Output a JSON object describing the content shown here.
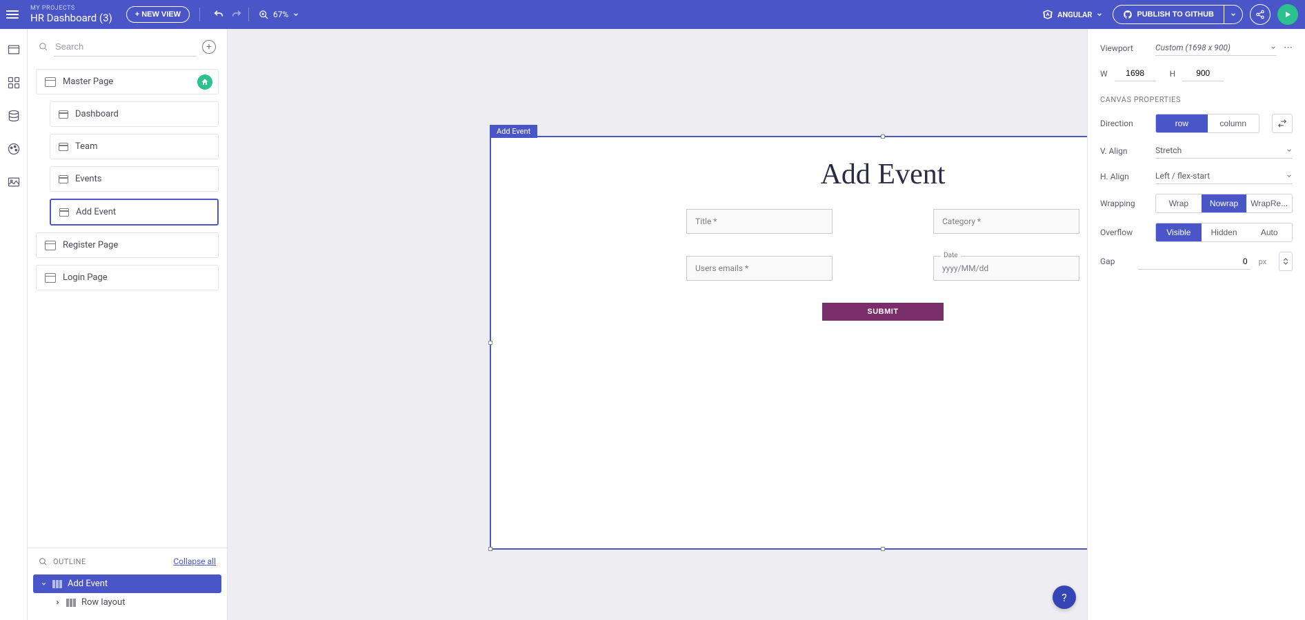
{
  "header": {
    "my_projects_label": "MY PROJECTS",
    "project_name": "HR Dashboard (3)",
    "new_view_label": "+ NEW VIEW",
    "zoom_value": "67%",
    "framework_label": "ANGULAR",
    "publish_label": "PUBLISH TO GITHUB"
  },
  "left_panel": {
    "search_placeholder": "Search",
    "pages": {
      "master": "Master Page",
      "dashboard": "Dashboard",
      "team": "Team",
      "events": "Events",
      "add_event": "Add Event",
      "register": "Register Page",
      "login": "Login Page"
    },
    "outline_label": "OUTLINE",
    "collapse_label": "Collapse all",
    "tree": {
      "root": "Add Event",
      "child": "Row layout"
    }
  },
  "canvas": {
    "selection_tag": "Add Event",
    "form": {
      "title": "Add Event",
      "field_title": "Title *",
      "field_category": "Category *",
      "field_users_emails": "Users emails *",
      "field_date_label": "Date",
      "field_date_placeholder": "yyyy/MM/dd",
      "submit_label": "SUBMIT"
    }
  },
  "right_panel": {
    "viewport_label": "Viewport",
    "viewport_value": "Custom (1698 x 900)",
    "w_label": "W",
    "w_value": "1698",
    "h_label": "H",
    "h_value": "900",
    "section_title": "CANVAS PROPERTIES",
    "direction_label": "Direction",
    "direction_row": "row",
    "direction_column": "column",
    "valign_label": "V. Align",
    "valign_value": "Stretch",
    "halign_label": "H. Align",
    "halign_value": "Left / flex-start",
    "wrapping_label": "Wrapping",
    "wrap_wrap": "Wrap",
    "wrap_nowrap": "Nowrap",
    "wrap_reverse": "WrapRe...",
    "overflow_label": "Overflow",
    "overflow_visible": "Visible",
    "overflow_hidden": "Hidden",
    "overflow_auto": "Auto",
    "gap_label": "Gap",
    "gap_value": "0",
    "gap_unit": "px"
  },
  "colors": {
    "primary": "#4a56c7",
    "accent": "#7b2d6b",
    "success": "#2cc28f"
  }
}
